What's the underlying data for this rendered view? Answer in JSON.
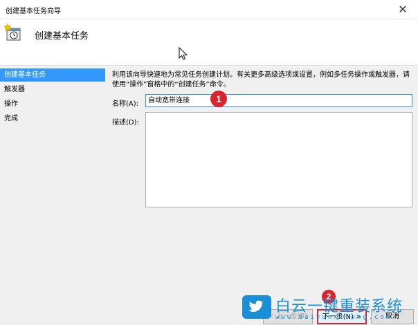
{
  "window": {
    "title": "创建基本任务向导",
    "close_glyph": "✕"
  },
  "header": {
    "title": "创建基本任务",
    "icon": "task-clock-icon"
  },
  "sidebar": {
    "items": [
      {
        "label": "创建基本任务",
        "active": true
      },
      {
        "label": "触发器",
        "active": false
      },
      {
        "label": "操作",
        "active": false
      },
      {
        "label": "完成",
        "active": false
      }
    ]
  },
  "content": {
    "description": "利用该向导快速地为常见任务创建计划。有关更多高级选项或设置，例如多任务操作或触发器，请使用“操作”窗格中的“创建任务”命令。",
    "name_label": "名称(A):",
    "name_value": "自动宽带连接",
    "desc_label": "描述(D):",
    "desc_value": ""
  },
  "annotations": {
    "badge1": "1",
    "badge2": "2"
  },
  "buttons": {
    "back": "< 上一步(B)",
    "next": "下一步(N) >",
    "cancel": "取消"
  },
  "watermark": {
    "text": "白云一键重装系统",
    "url": "www.baiyunxitong.com"
  },
  "colors": {
    "accent": "#3399ff",
    "badge": "#d9232d",
    "watermark": "#1a8fd8"
  }
}
